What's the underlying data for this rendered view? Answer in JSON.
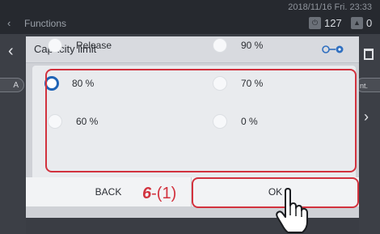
{
  "background": {
    "title": "Functions",
    "datetime": "2018/11/16 Fri. 23:33",
    "stat1_value": "127",
    "stat2_value": "0",
    "left_pill": "A",
    "right_pill": "nt."
  },
  "dialog": {
    "title": "Capacity limit",
    "options": [
      {
        "label": "Release",
        "selected": false
      },
      {
        "label": "80 %",
        "selected": true
      },
      {
        "label": "60 %",
        "selected": false
      },
      {
        "label": "90 %",
        "selected": false
      },
      {
        "label": "70 %",
        "selected": false
      },
      {
        "label": "0 %",
        "selected": false
      }
    ],
    "back_label": "BACK",
    "ok_label": "OK"
  },
  "annotation": {
    "step_number": "6",
    "step_suffix": "-(1)",
    "highlight_color": "#d2323e"
  },
  "colors": {
    "selected_radio": "#1f64b6",
    "dialog_bg": "#cfd1d6"
  },
  "icons": [
    "back-chevron-icon",
    "power-icon",
    "warning-icon",
    "toggle-icon",
    "trash-icon",
    "pointing-hand-icon"
  ]
}
